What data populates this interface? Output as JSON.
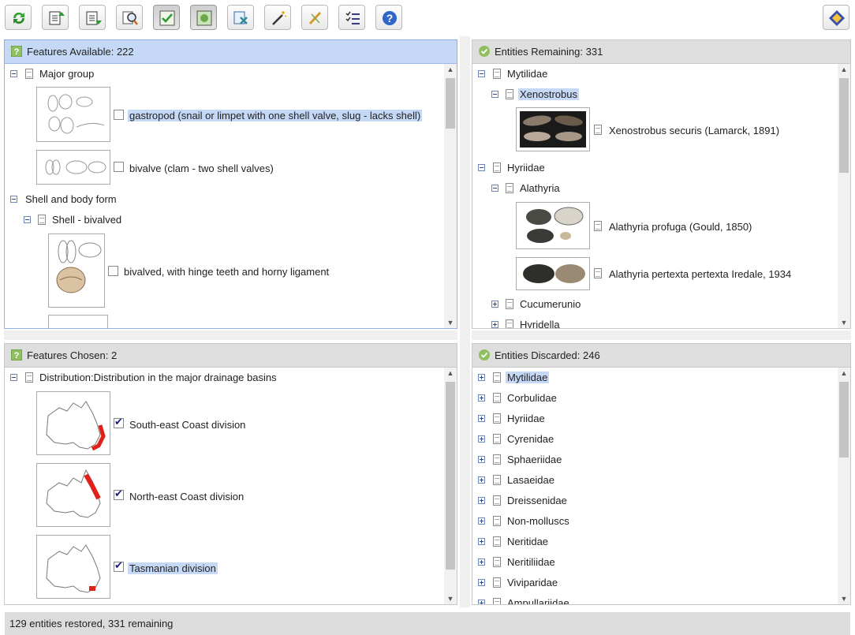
{
  "toolbar": {
    "buttons": [
      {
        "icon": "restart-icon"
      },
      {
        "icon": "feature-up-icon"
      },
      {
        "icon": "feature-down-icon"
      },
      {
        "icon": "find-icon"
      },
      {
        "icon": "features-chosen-icon"
      },
      {
        "icon": "entities-icon"
      },
      {
        "icon": "compare-icon"
      },
      {
        "icon": "magic-wand-icon"
      },
      {
        "icon": "prune-icon"
      },
      {
        "icon": "list-icon"
      },
      {
        "icon": "help-icon"
      },
      {
        "icon": "about-icon"
      }
    ]
  },
  "features_available": {
    "header": "Features Available: 222",
    "group1": "Major group",
    "gastropod": "gastropod (snail or limpet with one shell valve, slug - lacks shell)",
    "bivalve": "bivalve (clam - two shell valves)",
    "group2": "Shell and body form",
    "subgroup": "Shell - bivalved",
    "hinge": "bivalved, with hinge teeth and horny ligament"
  },
  "entities_remaining": {
    "header": "Entities Remaining: 331",
    "family1": "Mytilidae",
    "genus1": "Xenostrobus",
    "species1": "Xenostrobus securis (Lamarck, 1891)",
    "family2": "Hyriidae",
    "genus2": "Alathyria",
    "species2": "Alathyria profuga (Gould, 1850)",
    "species3": "Alathyria pertexta pertexta Iredale, 1934",
    "genus3": "Cucumerunio",
    "genus4": "Hyridella"
  },
  "features_chosen": {
    "header": "Features Chosen: 2",
    "group": "Distribution:Distribution in the major drainage basins",
    "items": [
      {
        "label": "South-east Coast division",
        "checked": true
      },
      {
        "label": "North-east Coast division",
        "checked": true
      },
      {
        "label": "Tasmanian division",
        "checked": true
      }
    ]
  },
  "entities_discarded": {
    "header": "Entities Discarded: 246",
    "items": [
      "Mytilidae",
      "Corbulidae",
      "Hyriidae",
      "Cyrenidae",
      "Sphaeriidae",
      "Lasaeidae",
      "Dreissenidae",
      "Non-molluscs",
      "Neritidae",
      "Neritiliidae",
      "Viviparidae",
      "Ampullariidae"
    ]
  },
  "status": "129 entities restored, 331 remaining",
  "colors": {
    "selection": "#c5d9f7",
    "map_highlight": "#e0201a",
    "panel_header": "#dedede"
  }
}
